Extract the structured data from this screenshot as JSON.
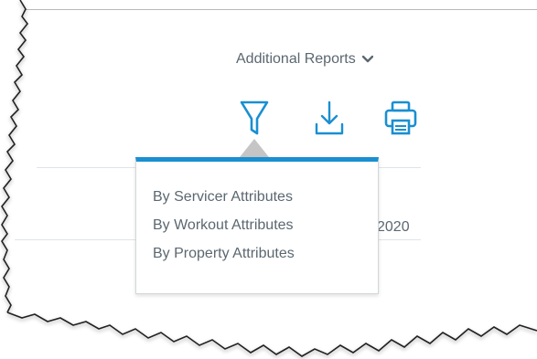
{
  "header": {
    "additional_reports_label": "Additional Reports"
  },
  "toolbar": {
    "icons": [
      "filter-icon",
      "download-icon",
      "print-icon"
    ]
  },
  "filter_menu": {
    "items": [
      {
        "label": "By Servicer Attributes"
      },
      {
        "label": "By Workout Attributes"
      },
      {
        "label": "By Property Attributes"
      }
    ]
  },
  "background": {
    "partial_date_text": "2020"
  },
  "colors": {
    "accent": "#1a8fd1",
    "text": "#5b6770",
    "divider": "#dfe4e8"
  }
}
